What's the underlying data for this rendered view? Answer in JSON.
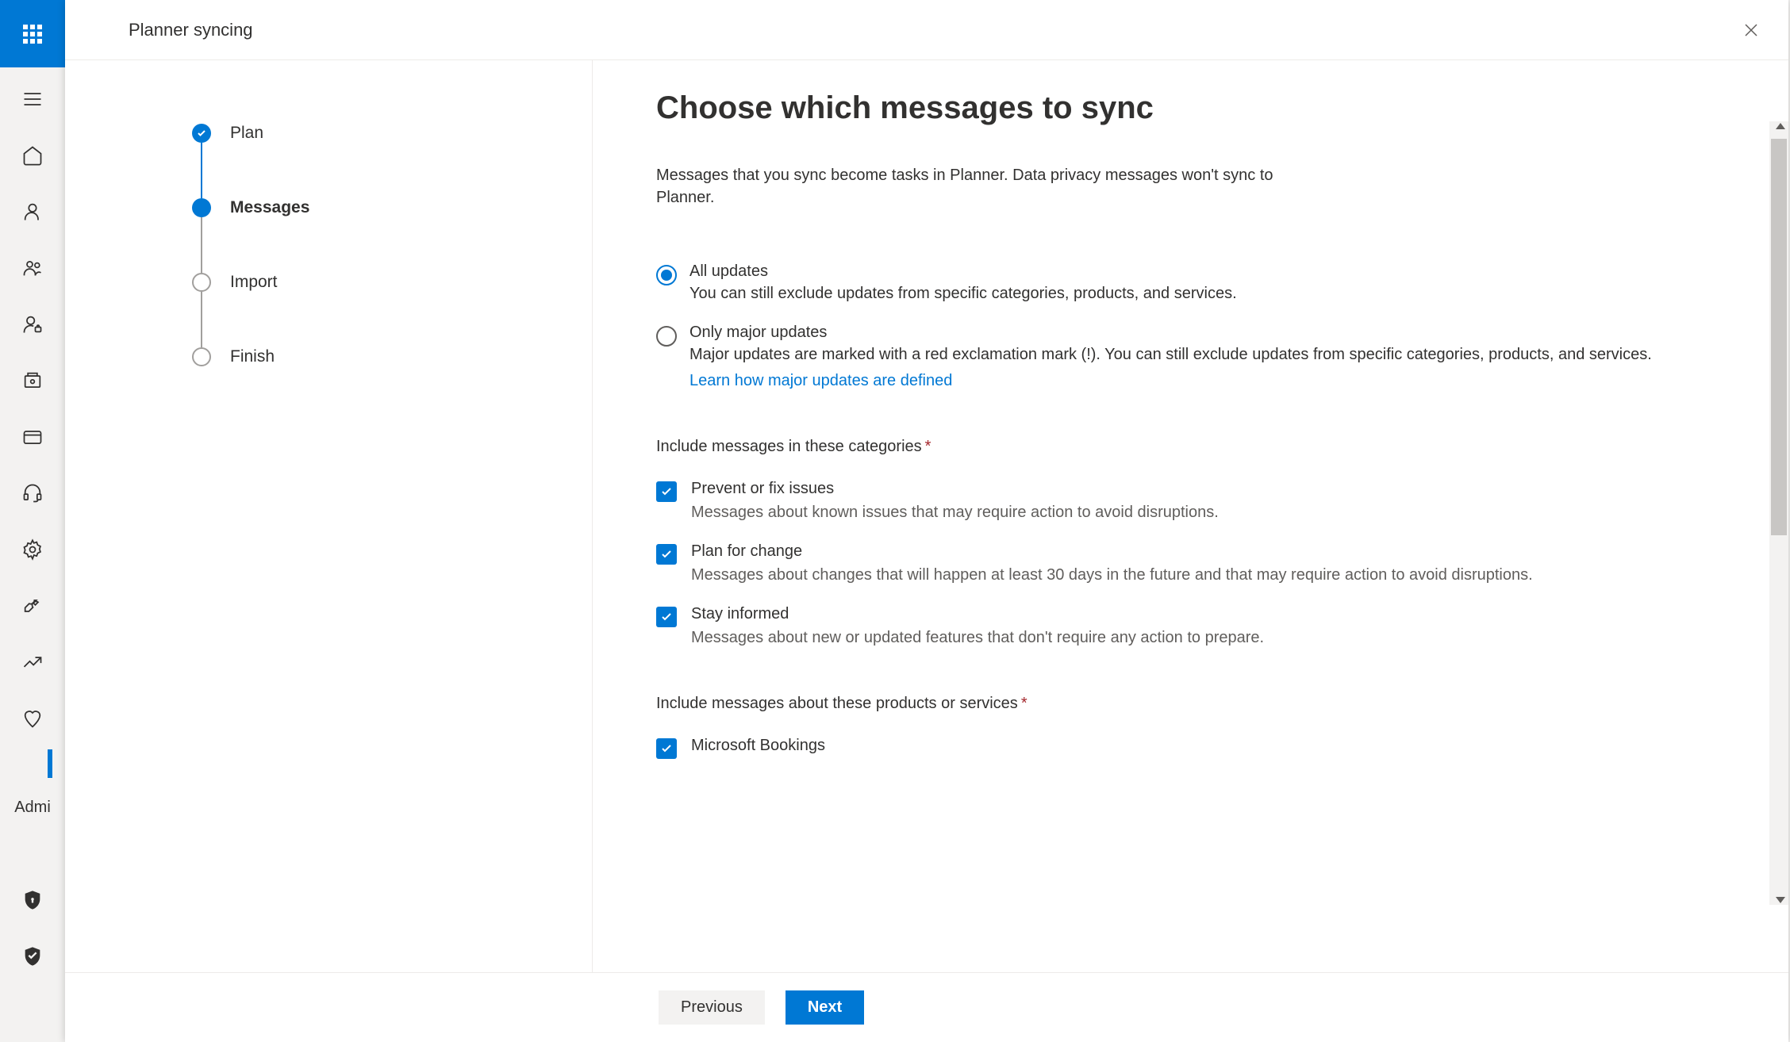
{
  "rail": {
    "label_text": "Admi"
  },
  "modal": {
    "header_title": "Planner syncing"
  },
  "wizard": {
    "steps": [
      {
        "label": "Plan",
        "state": "completed"
      },
      {
        "label": "Messages",
        "state": "active"
      },
      {
        "label": "Import",
        "state": "upcoming"
      },
      {
        "label": "Finish",
        "state": "upcoming"
      }
    ]
  },
  "content": {
    "title": "Choose which messages to sync",
    "description": "Messages that you sync become tasks in Planner. Data privacy messages won't sync to Planner.",
    "radio": {
      "all": {
        "title": "All updates",
        "desc": "You can still exclude updates from specific categories, products, and services."
      },
      "major": {
        "title": "Only major updates",
        "desc": "Major updates are marked with a red exclamation mark (!). You can still exclude updates from specific categories, products, and services.",
        "link": "Learn how major updates are defined"
      }
    },
    "categories_heading": "Include messages in these categories",
    "categories": [
      {
        "title": "Prevent or fix issues",
        "desc": "Messages about known issues that may require action to avoid disruptions."
      },
      {
        "title": "Plan for change",
        "desc": "Messages about changes that will happen at least 30 days in the future and that may require action to avoid disruptions."
      },
      {
        "title": "Stay informed",
        "desc": "Messages about new or updated features that don't require any action to prepare."
      }
    ],
    "products_heading": "Include messages about these products or services",
    "products": [
      {
        "title": "Microsoft Bookings"
      }
    ]
  },
  "footer": {
    "previous": "Previous",
    "next": "Next"
  }
}
